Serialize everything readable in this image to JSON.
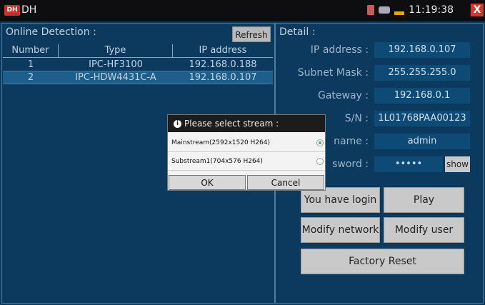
{
  "app": {
    "logo": "DH",
    "title": "DH",
    "time": "11:19:38",
    "close_label": "X"
  },
  "left_panel": {
    "title": "Online Detection :",
    "refresh_label": "Refresh",
    "columns": [
      "Number",
      "Type",
      "IP address"
    ],
    "rows": [
      {
        "number": "1",
        "type": "IPC-HF3100",
        "ip": "192.168.0.188"
      },
      {
        "number": "2",
        "type": "IPC-HDW4431C-A",
        "ip": "192.168.0.107"
      }
    ]
  },
  "detail": {
    "title": "Detail :",
    "ip_label": "IP address :",
    "ip_value": "192.168.0.107",
    "mask_label": "Subnet Mask :",
    "mask_value": "255.255.255.0",
    "gateway_label": "Gateway :",
    "gateway_value": "192.168.0.1",
    "sn_label": "S/N :",
    "sn_value": "1L01768PAA00123",
    "name_label": "name :",
    "name_value": "admin",
    "password_label": "sword :",
    "password_value": "•••••",
    "show_label": "show"
  },
  "actions": {
    "login": "You have login",
    "play": "Play",
    "modify_network": "Modify network",
    "modify_user": "Modify user",
    "factory_reset": "Factory Reset"
  },
  "dialog": {
    "title": "Please select stream :",
    "options": [
      "Mainstream(2592x1520 H264)",
      "Substream1(704x576 H264)"
    ],
    "selected_index": 0,
    "ok_label": "OK",
    "cancel_label": "Cancel"
  },
  "colors": {
    "background": "#0b3a5e",
    "value_box": "#0e4a76",
    "close": "#d8342c"
  }
}
